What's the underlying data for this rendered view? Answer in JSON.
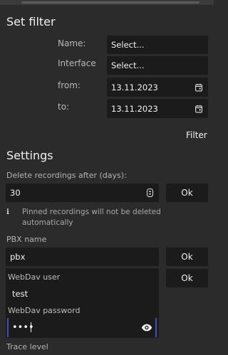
{
  "filter": {
    "title": "Set filter",
    "name_label": "Name:",
    "name_value": "Select...",
    "interface_label": "Interface",
    "interface_value": "Select...",
    "from_label": "from:",
    "from_value": "13.11.2023",
    "to_label": "to:",
    "to_value": "13.11.2023",
    "filter_button": "Filter"
  },
  "settings": {
    "title": "Settings",
    "delete_label": "Delete recordings after (days):",
    "delete_value": "30",
    "delete_ok": "Ok",
    "info_icon": "i",
    "info_text": "Pinned recordings will not be deleted automatically",
    "pbx_label": "PBX name",
    "pbx_value": "pbx",
    "pbx_ok": "Ok",
    "webdav_user_label": "WebDav user",
    "webdav_user_value": "test",
    "webdav_ok": "Ok",
    "webdav_password_label": "WebDav password",
    "webdav_password_value": "••••",
    "trace_label": "Trace level"
  },
  "icons": {
    "calendar": "calendar-icon",
    "spinner": "spin-arrows-icon",
    "eye": "eye-icon",
    "info": "info-icon"
  },
  "colors": {
    "background": "#2b2b2b",
    "field": "#1b1b1b",
    "focus": "#3f51b5"
  }
}
